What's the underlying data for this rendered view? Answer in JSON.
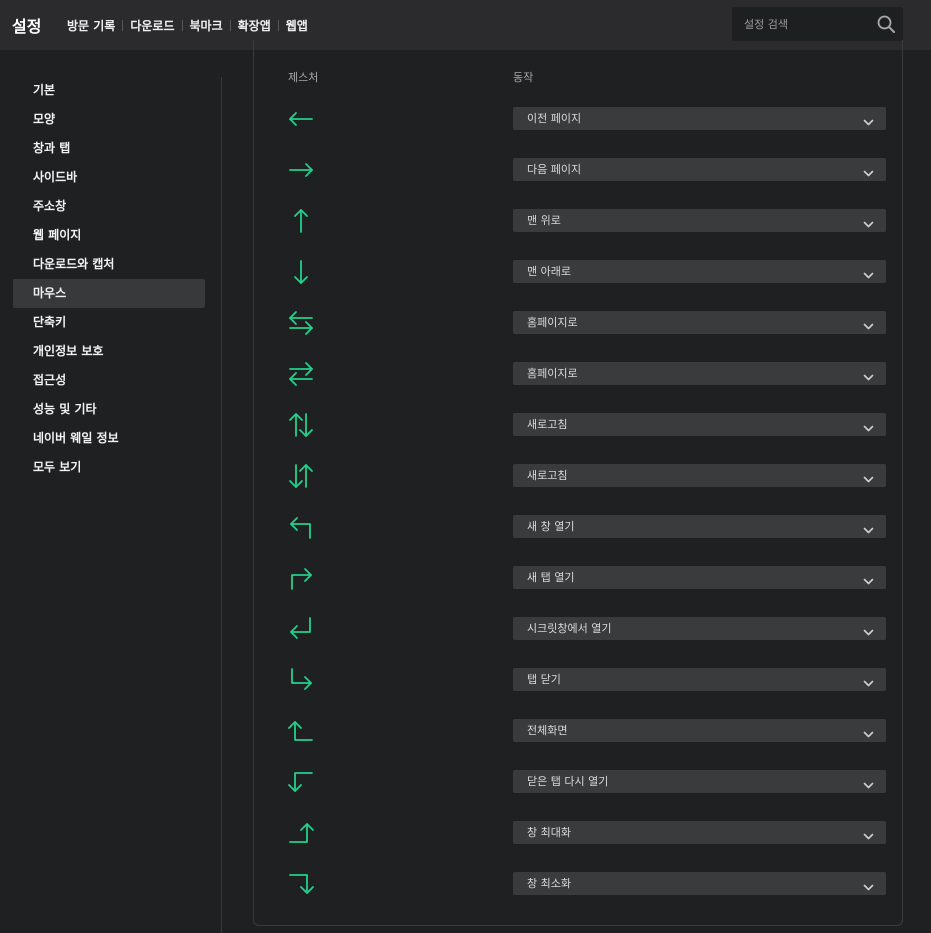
{
  "header": {
    "title": "설정",
    "nav": [
      "방문 기록",
      "다운로드",
      "북마크",
      "확장앱",
      "웹앱"
    ],
    "search_placeholder": "설정 검색"
  },
  "sidebar": {
    "items": [
      {
        "label": "기본"
      },
      {
        "label": "모양"
      },
      {
        "label": "창과 탭"
      },
      {
        "label": "사이드바"
      },
      {
        "label": "주소창"
      },
      {
        "label": "웹 페이지"
      },
      {
        "label": "다운로드와 캡처"
      },
      {
        "label": "마우스",
        "active": true
      },
      {
        "label": "단축키"
      },
      {
        "label": "개인정보 보호"
      },
      {
        "label": "접근성"
      },
      {
        "label": "성능 및 기타"
      },
      {
        "label": "네이버 웨일 정보"
      },
      {
        "label": "모두 보기"
      }
    ]
  },
  "gestures": {
    "header_gesture": "제스처",
    "header_action": "동작",
    "accent_color": "#22d18b",
    "rows": [
      {
        "gesture_icon": "arrow-left-icon",
        "action": "이전 페이지"
      },
      {
        "gesture_icon": "arrow-right-icon",
        "action": "다음 페이지"
      },
      {
        "gesture_icon": "arrow-up-icon",
        "action": "맨 위로"
      },
      {
        "gesture_icon": "arrow-down-icon",
        "action": "맨 아래로"
      },
      {
        "gesture_icon": "left-then-right-icon",
        "action": "홈페이지로"
      },
      {
        "gesture_icon": "right-then-left-icon",
        "action": "홈페이지로"
      },
      {
        "gesture_icon": "up-then-down-icon",
        "action": "새로고침"
      },
      {
        "gesture_icon": "down-then-up-icon",
        "action": "새로고침"
      },
      {
        "gesture_icon": "up-then-left-icon",
        "action": "새 창 열기"
      },
      {
        "gesture_icon": "up-then-right-icon",
        "action": "새 탭 열기"
      },
      {
        "gesture_icon": "down-then-left-icon",
        "action": "시크릿창에서 열기"
      },
      {
        "gesture_icon": "down-then-right-icon",
        "action": "탭 닫기"
      },
      {
        "gesture_icon": "left-then-up-icon",
        "action": "전체화면"
      },
      {
        "gesture_icon": "left-then-down-icon",
        "action": "닫은 탭 다시 열기"
      },
      {
        "gesture_icon": "right-then-up-icon",
        "action": "창 최대화"
      },
      {
        "gesture_icon": "right-then-down-icon",
        "action": "창 최소화"
      }
    ]
  }
}
